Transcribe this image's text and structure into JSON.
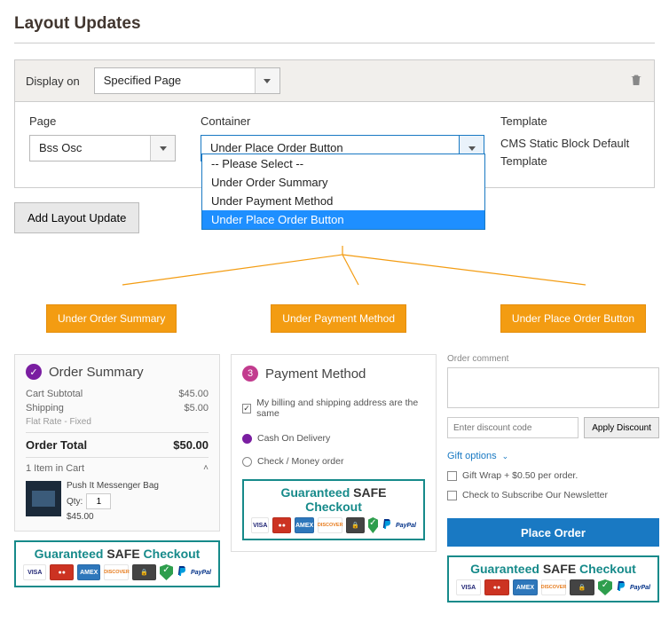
{
  "title": "Layout Updates",
  "panel": {
    "display_on_label": "Display on",
    "display_on_value": "Specified Page"
  },
  "fields": {
    "page": {
      "label": "Page",
      "value": "Bss Osc"
    },
    "container": {
      "label": "Container",
      "value": "Under Place Order Button",
      "options": [
        "-- Please Select --",
        "Under Order Summary",
        "Under Payment Method",
        "Under Place Order Button"
      ]
    },
    "template": {
      "label": "Template",
      "value": "CMS Static Block Default Template"
    }
  },
  "buttons": {
    "add_layout": "Add Layout Update"
  },
  "callouts": {
    "c1": "Under Order Summary",
    "c2": "Under Payment Method",
    "c3": "Under Place Order Button"
  },
  "order_summary": {
    "step": "✓",
    "title": "Order Summary",
    "subtotal_label": "Cart Subtotal",
    "subtotal": "$45.00",
    "shipping_label": "Shipping",
    "shipping": "$5.00",
    "shipping_method": "Flat Rate - Fixed",
    "total_label": "Order Total",
    "total": "$50.00",
    "items_line": "1 Item in Cart",
    "item_name": "Push It Messenger Bag",
    "qty_label": "Qty:",
    "qty": "1",
    "item_price": "$45.00"
  },
  "payment": {
    "step": "3",
    "title": "Payment Method",
    "same_addr": "My billing and shipping address are the same",
    "m1": "Cash On Delivery",
    "m2": "Check / Money order"
  },
  "place": {
    "comment_label": "Order comment",
    "discount_placeholder": "Enter discount code",
    "apply": "Apply Discount",
    "gift_label": "Gift options",
    "giftwrap": "Gift Wrap + $0.50 per order.",
    "newsletter": "Check to Subscribe Our Newsletter",
    "button": "Place Order"
  },
  "safe": {
    "pre": "Guaranteed ",
    "safe": "SAFE",
    "post": " Checkout",
    "visa": "VISA",
    "mc": "●●",
    "amex": "AMEX",
    "disc": "DISCOVER",
    "lock": "🔒",
    "pp": "PayPal"
  }
}
